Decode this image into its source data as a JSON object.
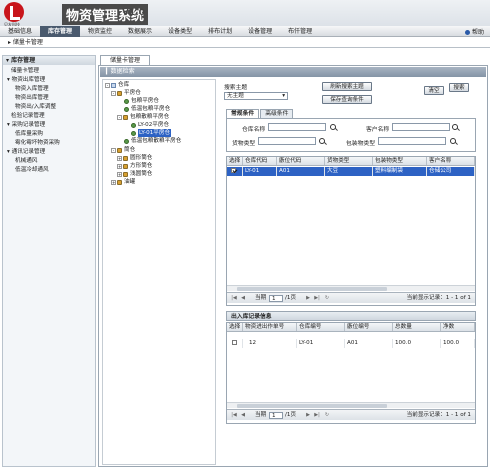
{
  "header": {
    "company": "贝友科技",
    "app_title": "物资管理系统",
    "version": "V1.0",
    "help": "帮助"
  },
  "nav": [
    "基础信息",
    "库存管理",
    "物资监控",
    "数据展示",
    "设备类型",
    "排布计划",
    "设备管理",
    "布仟管理"
  ],
  "breadcrumb": "储量卡管理",
  "sidebar": {
    "title": "库存管理",
    "items": [
      "储量卡管理",
      "物资出库管理",
      "物资入库管理",
      "物资出库管理",
      "物资出/入库调整",
      "检验记录管理",
      "采购记录管理",
      "低库量采购",
      "霉化霉坏物资采购",
      "通讯记录管理",
      "机械通风",
      "低温冷却通风"
    ]
  },
  "main_tab": "储量卡管理",
  "catalog_title": "数据检索",
  "tree": [
    "仓库",
    "平房仓",
    "包粮平房仓",
    "低温包粮平房仓",
    "包粮散粮平房仓",
    "LY-02平房仓",
    "LY-01平房仓",
    "低温包粮散粮平房仓",
    "筒仓",
    "圆形筒仓",
    "方形筒仓",
    "浅圆筒仓",
    "油罐"
  ],
  "search": {
    "topic_label": "搜索主题",
    "topic_value": "无主题",
    "refresh_btn": "刷新搜索主题",
    "save_btn": "保存查询条件",
    "clear_btn": "清空",
    "search_btn": "搜索",
    "tab_basic": "常规条件",
    "tab_adv": "高级条件",
    "f_warehouse_name": "仓库名称",
    "f_customer_name": "客户名称",
    "f_goods_type": "货物类型",
    "f_package_type": "包装物类型"
  },
  "grid1": {
    "columns": [
      "选择",
      "仓库代码",
      "廒位代码",
      "货物类型",
      "包装物类型",
      "客户名称"
    ],
    "rows": [
      [
        "",
        "LY-01",
        "A01",
        "大豆",
        "塑料编制袋",
        "仓储公司"
      ]
    ],
    "pager": {
      "page_prefix": "当期",
      "page": "1",
      "page_suffix": "/1页",
      "info": "当前显示记录：1 - 1 of 1"
    }
  },
  "grid2": {
    "title": "出入库记录信息",
    "columns": [
      "选择",
      "物资进出作单号",
      "仓库编号",
      "廒位编号",
      "总数量",
      "净数"
    ],
    "rows": [
      [
        "",
        "12",
        "LY-01",
        "A01",
        "100.0",
        "100.0"
      ]
    ],
    "pager": {
      "page_prefix": "当期",
      "page": "1",
      "page_suffix": "/1页",
      "info": "当前显示记录：1 - 1 of 1"
    }
  }
}
